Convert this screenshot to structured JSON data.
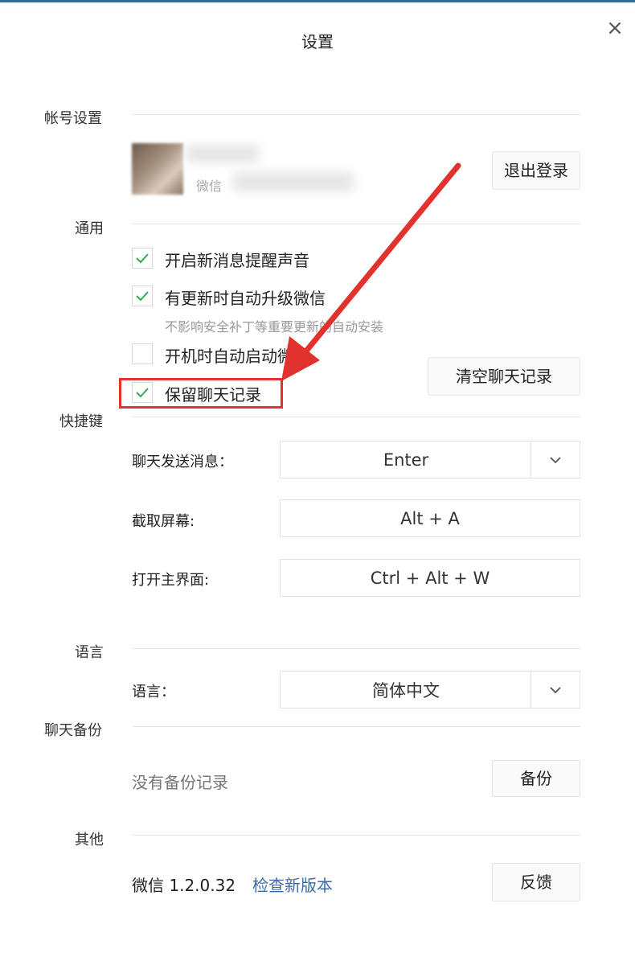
{
  "window": {
    "title": "设置"
  },
  "account": {
    "section_label": "帐号设置",
    "wechat_prefix": "微信",
    "logout_label": "退出登录"
  },
  "general": {
    "section_label": "通用",
    "options": [
      {
        "label": "开启新消息提醒声音",
        "checked": true
      },
      {
        "label": "有更新时自动升级微信",
        "checked": true
      },
      {
        "label": "开机时自动启动微信",
        "checked": false
      },
      {
        "label": "保留聊天记录",
        "checked": true
      }
    ],
    "update_sub": "不影响安全补丁等重要更新的自动安装",
    "clear_label": "清空聊天记录"
  },
  "shortcuts": {
    "section_label": "快捷键",
    "items": [
      {
        "label": "聊天发送消息：",
        "value": "Enter"
      },
      {
        "label": "截取屏幕:",
        "value": "Alt + A"
      },
      {
        "label": "打开主界面:",
        "value": "Ctrl + Alt + W"
      }
    ]
  },
  "language": {
    "section_label": "语言",
    "label": "语言：",
    "value": "简体中文"
  },
  "backup": {
    "section_label": "聊天备份",
    "status": "没有备份记录",
    "button_label": "备份"
  },
  "other": {
    "section_label": "其他",
    "version": "微信 1.2.0.32",
    "check_update": "检查新版本",
    "feedback_label": "反馈"
  },
  "colors": {
    "accent": "#e2322d",
    "link": "#3e6aa8",
    "check": "#3aa757"
  },
  "icons": {
    "close": "close-icon",
    "check": "check-icon",
    "dropdown": "chevron-down-icon",
    "annotation": "red-arrow-annotation"
  }
}
